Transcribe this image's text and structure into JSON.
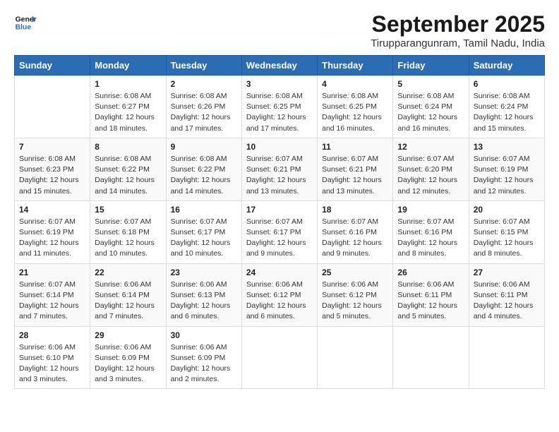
{
  "logo": {
    "line1": "General",
    "line2": "Blue"
  },
  "title": "September 2025",
  "location": "Tirupparangunram, Tamil Nadu, India",
  "days": [
    "Sunday",
    "Monday",
    "Tuesday",
    "Wednesday",
    "Thursday",
    "Friday",
    "Saturday"
  ],
  "weeks": [
    [
      {
        "day": "",
        "info": ""
      },
      {
        "day": "1",
        "info": "Sunrise: 6:08 AM\nSunset: 6:27 PM\nDaylight: 12 hours\nand 18 minutes."
      },
      {
        "day": "2",
        "info": "Sunrise: 6:08 AM\nSunset: 6:26 PM\nDaylight: 12 hours\nand 17 minutes."
      },
      {
        "day": "3",
        "info": "Sunrise: 6:08 AM\nSunset: 6:25 PM\nDaylight: 12 hours\nand 17 minutes."
      },
      {
        "day": "4",
        "info": "Sunrise: 6:08 AM\nSunset: 6:25 PM\nDaylight: 12 hours\nand 16 minutes."
      },
      {
        "day": "5",
        "info": "Sunrise: 6:08 AM\nSunset: 6:24 PM\nDaylight: 12 hours\nand 16 minutes."
      },
      {
        "day": "6",
        "info": "Sunrise: 6:08 AM\nSunset: 6:24 PM\nDaylight: 12 hours\nand 15 minutes."
      }
    ],
    [
      {
        "day": "7",
        "info": "Sunrise: 6:08 AM\nSunset: 6:23 PM\nDaylight: 12 hours\nand 15 minutes."
      },
      {
        "day": "8",
        "info": "Sunrise: 6:08 AM\nSunset: 6:22 PM\nDaylight: 12 hours\nand 14 minutes."
      },
      {
        "day": "9",
        "info": "Sunrise: 6:08 AM\nSunset: 6:22 PM\nDaylight: 12 hours\nand 14 minutes."
      },
      {
        "day": "10",
        "info": "Sunrise: 6:07 AM\nSunset: 6:21 PM\nDaylight: 12 hours\nand 13 minutes."
      },
      {
        "day": "11",
        "info": "Sunrise: 6:07 AM\nSunset: 6:21 PM\nDaylight: 12 hours\nand 13 minutes."
      },
      {
        "day": "12",
        "info": "Sunrise: 6:07 AM\nSunset: 6:20 PM\nDaylight: 12 hours\nand 12 minutes."
      },
      {
        "day": "13",
        "info": "Sunrise: 6:07 AM\nSunset: 6:19 PM\nDaylight: 12 hours\nand 12 minutes."
      }
    ],
    [
      {
        "day": "14",
        "info": "Sunrise: 6:07 AM\nSunset: 6:19 PM\nDaylight: 12 hours\nand 11 minutes."
      },
      {
        "day": "15",
        "info": "Sunrise: 6:07 AM\nSunset: 6:18 PM\nDaylight: 12 hours\nand 10 minutes."
      },
      {
        "day": "16",
        "info": "Sunrise: 6:07 AM\nSunset: 6:17 PM\nDaylight: 12 hours\nand 10 minutes."
      },
      {
        "day": "17",
        "info": "Sunrise: 6:07 AM\nSunset: 6:17 PM\nDaylight: 12 hours\nand 9 minutes."
      },
      {
        "day": "18",
        "info": "Sunrise: 6:07 AM\nSunset: 6:16 PM\nDaylight: 12 hours\nand 9 minutes."
      },
      {
        "day": "19",
        "info": "Sunrise: 6:07 AM\nSunset: 6:16 PM\nDaylight: 12 hours\nand 8 minutes."
      },
      {
        "day": "20",
        "info": "Sunrise: 6:07 AM\nSunset: 6:15 PM\nDaylight: 12 hours\nand 8 minutes."
      }
    ],
    [
      {
        "day": "21",
        "info": "Sunrise: 6:07 AM\nSunset: 6:14 PM\nDaylight: 12 hours\nand 7 minutes."
      },
      {
        "day": "22",
        "info": "Sunrise: 6:06 AM\nSunset: 6:14 PM\nDaylight: 12 hours\nand 7 minutes."
      },
      {
        "day": "23",
        "info": "Sunrise: 6:06 AM\nSunset: 6:13 PM\nDaylight: 12 hours\nand 6 minutes."
      },
      {
        "day": "24",
        "info": "Sunrise: 6:06 AM\nSunset: 6:12 PM\nDaylight: 12 hours\nand 6 minutes."
      },
      {
        "day": "25",
        "info": "Sunrise: 6:06 AM\nSunset: 6:12 PM\nDaylight: 12 hours\nand 5 minutes."
      },
      {
        "day": "26",
        "info": "Sunrise: 6:06 AM\nSunset: 6:11 PM\nDaylight: 12 hours\nand 5 minutes."
      },
      {
        "day": "27",
        "info": "Sunrise: 6:06 AM\nSunset: 6:11 PM\nDaylight: 12 hours\nand 4 minutes."
      }
    ],
    [
      {
        "day": "28",
        "info": "Sunrise: 6:06 AM\nSunset: 6:10 PM\nDaylight: 12 hours\nand 3 minutes."
      },
      {
        "day": "29",
        "info": "Sunrise: 6:06 AM\nSunset: 6:09 PM\nDaylight: 12 hours\nand 3 minutes."
      },
      {
        "day": "30",
        "info": "Sunrise: 6:06 AM\nSunset: 6:09 PM\nDaylight: 12 hours\nand 2 minutes."
      },
      {
        "day": "",
        "info": ""
      },
      {
        "day": "",
        "info": ""
      },
      {
        "day": "",
        "info": ""
      },
      {
        "day": "",
        "info": ""
      }
    ]
  ]
}
